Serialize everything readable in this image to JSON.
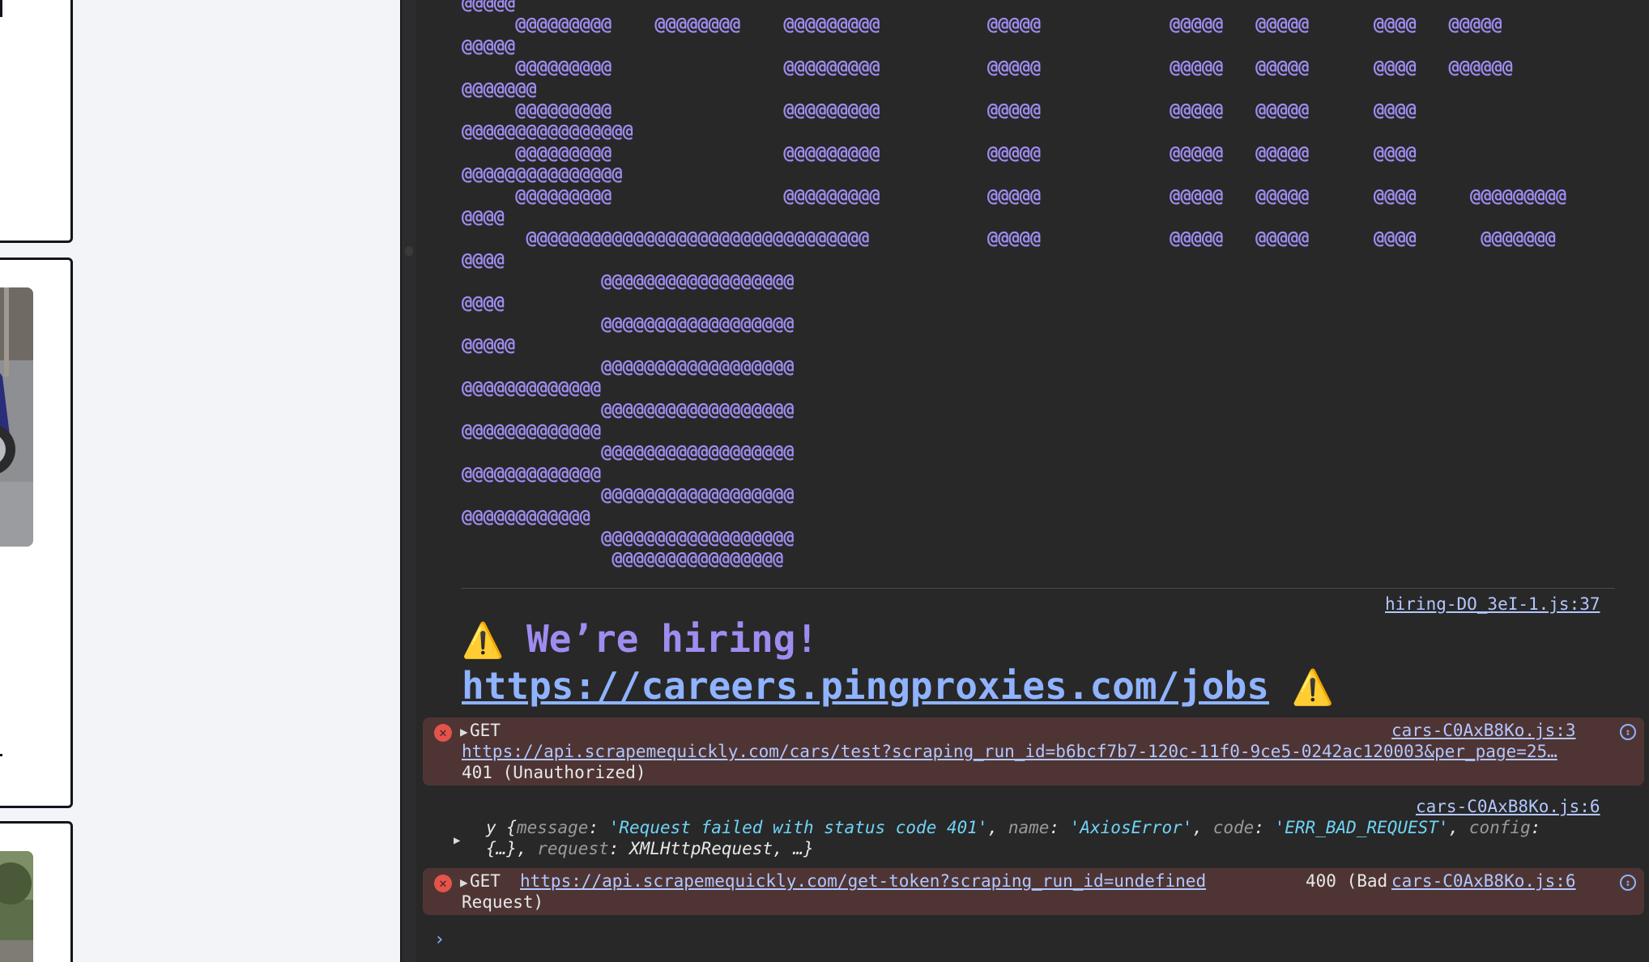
{
  "console": {
    "ascii_art": [
      "@@@@@",
      "     @@@@@@@@@    @@@@@@@@    @@@@@@@@@          @@@@@            @@@@@   @@@@@      @@@@   @@@@@",
      "@@@@@",
      "     @@@@@@@@@                @@@@@@@@@          @@@@@            @@@@@   @@@@@      @@@@   @@@@@@",
      "@@@@@@@",
      "     @@@@@@@@@                @@@@@@@@@          @@@@@            @@@@@   @@@@@      @@@@",
      "@@@@@@@@@@@@@@@@",
      "     @@@@@@@@@                @@@@@@@@@          @@@@@            @@@@@   @@@@@      @@@@",
      "@@@@@@@@@@@@@@@",
      "     @@@@@@@@@                @@@@@@@@@          @@@@@            @@@@@   @@@@@      @@@@     @@@@@@@@@",
      "@@@@",
      "      @@@@@@@@@@@@@@@@@@@@@@@@@@@@@@@@           @@@@@            @@@@@   @@@@@      @@@@      @@@@@@@",
      "@@@@",
      "             @@@@@@@@@@@@@@@@@@",
      "@@@@",
      "             @@@@@@@@@@@@@@@@@@",
      "@@@@@",
      "             @@@@@@@@@@@@@@@@@@",
      "@@@@@@@@@@@@@",
      "             @@@@@@@@@@@@@@@@@@",
      "@@@@@@@@@@@@@",
      "             @@@@@@@@@@@@@@@@@@",
      "@@@@@@@@@@@@@",
      "             @@@@@@@@@@@@@@@@@@",
      "@@@@@@@@@@@@",
      "             @@@@@@@@@@@@@@@@@@",
      "              @@@@@@@@@@@@@@@@"
    ],
    "hiring": {
      "source": "hiring-DO_3eI-1.js:37",
      "warn_glyph": "⚠️",
      "text": "We’re hiring!",
      "url": "https://careers.pingproxies.com/jobs"
    },
    "errors": [
      {
        "method": "GET",
        "url": "https://api.scrapemequickly.com/cars/test?scraping_run_id=b6bcf7b7-120c-11f0-9ce5-0242ac120003&per_page=25…",
        "status": "401 (Unauthorized)",
        "source": "cars-C0AxB8Ko.js:3"
      },
      {
        "method": "GET",
        "url": "https://api.scrapemequickly.com/get-token?scraping_run_id=undefined",
        "status_a": "400 (Bad",
        "status_b": "Request)",
        "source": "cars-C0AxB8Ko.js:6"
      }
    ],
    "object_log": {
      "source": "cars-C0AxB8Ko.js:6",
      "class_name": "y",
      "message_key": "message",
      "message_val": "'Request failed with status code 401'",
      "name_key": "name",
      "name_val": "'AxiosError'",
      "code_key": "code",
      "code_val": "'ERR_BAD_REQUEST'",
      "config_key": "config",
      "config_val": "{…}",
      "request_key": "request",
      "request_val": "XMLHttpRequest",
      "ellipsis": "…}"
    },
    "prompt_glyph": "›"
  },
  "colors": {
    "console_bg": "#282828",
    "ascii_purple": "#a08cf0",
    "error_row_bg": "#4e3534",
    "link_blue": "#b3c7ff",
    "string_cyan": "#6fd4f7"
  }
}
